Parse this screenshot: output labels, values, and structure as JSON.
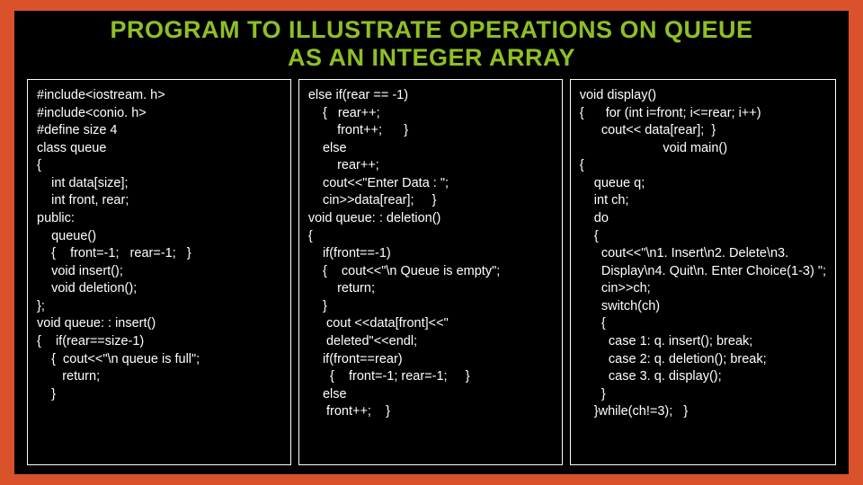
{
  "title_line1": "PROGRAM TO ILLUSTRATE OPERATIONS ON QUEUE",
  "title_line2": "AS AN INTEGER ARRAY",
  "col1": "#include<iostream. h>\n#include<conio. h>\n#define size 4\nclass queue\n{\n    int data[size];\n    int front, rear;\npublic:\n    queue()\n    {    front=-1;   rear=-1;   }\n    void insert();\n    void deletion();\n};\nvoid queue: : insert()\n{    if(rear==size-1)\n    {  cout<<\"\\n queue is full\";\n       return;\n    }",
  "col2": "else if(rear == -1)\n    {   rear++;\n        front++;      }\n    else\n        rear++;\n    cout<<\"Enter Data : \";\n    cin>>data[rear];     }\nvoid queue: : deletion()\n{\n    if(front==-1)\n    {    cout<<\"\\n Queue is empty\";\n        return;\n    }\n     cout <<data[front]<<\"\n     deleted\"<<endl;\n    if(front==rear)\n      {    front=-1; rear=-1;     }\n    else\n     front++;    }",
  "col3": "void display()\n{      for (int i=front; i<=rear; i++)\n      cout<< data[rear];  }\n                       void main()\n{\n    queue q;\n    int ch;\n    do\n    {\n      cout<<\"\\n1. Insert\\n2. Delete\\n3.\n      Display\\n4. Quit\\n. Enter Choice(1-3) \";\n      cin>>ch;\n      switch(ch)\n      {\n        case 1: q. insert(); break;\n        case 2: q. deletion(); break;\n        case 3. q. display();\n      }\n    }while(ch!=3);   }"
}
